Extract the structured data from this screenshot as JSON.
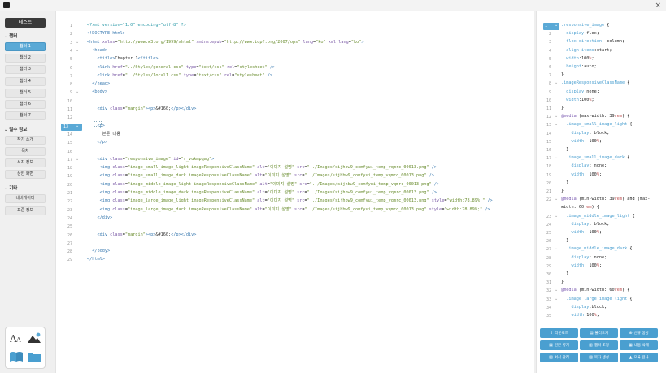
{
  "window": {
    "close_glyph": "×"
  },
  "sidebar": {
    "top_button": "테스트",
    "sections": [
      {
        "label": "챕터"
      },
      {
        "label": "필수 정보"
      },
      {
        "label": "기타"
      }
    ],
    "chapters": [
      "챕터 1",
      "챕터 2",
      "챕터 3",
      "챕터 4",
      "챕터 5",
      "챕터 6",
      "챕터 7"
    ],
    "required_info": [
      "작가 소개",
      "목차",
      "서지 정보",
      "상한 화면"
    ],
    "etc": [
      "내비게이터",
      "표준 정보"
    ],
    "tools": [
      "font-icon",
      "image-icon",
      "book-icon",
      "folder-icon"
    ]
  },
  "editor": {
    "highlighted_line": "13",
    "lines": [
      {
        "n": "1",
        "fold": "",
        "html": "<span class='pi'>&lt;?xml version=\"1.0\" encoding=\"utf-8\" ?&gt;</span>"
      },
      {
        "n": "2",
        "fold": "",
        "html": "<span class='tag'>&lt;!DOCTYPE html&gt;</span>"
      },
      {
        "n": "3",
        "fold": "⌄",
        "html": "<span class='tag'>&lt;html</span> <span class='attr'>xmlns</span>=<span class='str'>\"http://www.w3.org/1999/xhtml\"</span> <span class='attr'>xmlns:epub</span>=<span class='str'>\"http://www.idpf.org/2007/ops\"</span> <span class='attr'>lang</span>=<span class='str'>\"ko\"</span> <span class='attr'>xml:lang</span>=<span class='str'>\"ko\"</span><span class='tag'>&gt;</span>"
      },
      {
        "n": "4",
        "fold": "⌄",
        "html": "  <span class='tag'>&lt;head&gt;</span>"
      },
      {
        "n": "5",
        "fold": "",
        "html": "    <span class='tag'>&lt;title&gt;</span><span class='txt'>Chapter 1</span><span class='tag'>&lt;/title&gt;</span>"
      },
      {
        "n": "6",
        "fold": "",
        "html": "    <span class='tag'>&lt;link</span> <span class='attr'>href</span>=<span class='str'>\"../Styles/general.css\"</span> <span class='attr'>type</span>=<span class='str'>\"text/css\"</span> <span class='attr'>rel</span>=<span class='str'>\"stylesheet\"</span> <span class='tag'>/&gt;</span>"
      },
      {
        "n": "7",
        "fold": "",
        "html": "    <span class='tag'>&lt;link</span> <span class='attr'>href</span>=<span class='str'>\"../Styles/local1.css\"</span> <span class='attr'>type</span>=<span class='str'>\"text/css\"</span> <span class='attr'>rel</span>=<span class='str'>\"stylesheet\"</span> <span class='tag'>/&gt;</span>"
      },
      {
        "n": "8",
        "fold": "",
        "html": "  <span class='tag'>&lt;/head&gt;</span>"
      },
      {
        "n": "9",
        "fold": "⌄",
        "html": "  <span class='tag'>&lt;body&gt;</span>"
      },
      {
        "n": "10",
        "fold": "",
        "html": ""
      },
      {
        "n": "11",
        "fold": "",
        "html": "    <span class='tag'>&lt;div</span> <span class='attr'>class</span>=<span class='str'>\"margin\"</span><span class='tag'>&gt;&lt;p&gt;</span><span class='txt'>&amp;#160;</span><span class='tag'>&lt;/p&gt;&lt;/div&gt;</span>"
      },
      {
        "n": "12",
        "fold": "",
        "html": ""
      },
      {
        "n": "13",
        "fold": "⌄",
        "html": "    <span class='tag'>&lt;p&gt;</span>"
      },
      {
        "n": "14",
        "fold": "",
        "html": "      <span class='txt'>본문 내용</span>"
      },
      {
        "n": "15",
        "fold": "",
        "html": "    <span class='tag'>&lt;/p&gt;</span>"
      },
      {
        "n": "16",
        "fold": "",
        "html": ""
      },
      {
        "n": "17",
        "fold": "⌄",
        "html": "    <span class='tag'>&lt;div</span> <span class='attr'>class</span>=<span class='str'>\"responsive_image\"</span> <span class='attr'>id</span>=<span class='str'>\"r_vukmpqag\"</span><span class='tag'>&gt;</span>"
      },
      {
        "n": "18",
        "fold": "",
        "html": "     <span class='tag'>&lt;img</span> <span class='attr'>class</span>=<span class='str'>\"image_small_image_light imageResponsiveClassName\"</span> <span class='attr'>alt</span>=<span class='str'>\"이미지 설명\"</span> <span class='attr'>src</span>=<span class='str'>\"../Images/sijhbw9_comfyui_temp_vqmrc_00013.png\"</span> <span class='tag'>/&gt;</span>"
      },
      {
        "n": "19",
        "fold": "",
        "html": "     <span class='tag'>&lt;img</span> <span class='attr'>class</span>=<span class='str'>\"image_small_image_dark imageResponsiveClassName\"</span> <span class='attr'>alt</span>=<span class='str'>\"이미지 설명\"</span> <span class='attr'>src</span>=<span class='str'>\"../Images/sijhbw9_comfyui_temp_vqmrc_00013.png\"</span> <span class='tag'>/&gt;</span>"
      },
      {
        "n": "20",
        "fold": "",
        "html": "     <span class='tag'>&lt;img</span> <span class='attr'>class</span>=<span class='str'>\"image_middle_image_light imageResponsiveClassName\"</span> <span class='attr'>alt</span>=<span class='str'>\"이미지 설명\"</span> <span class='attr'>src</span>=<span class='str'>\"../Images/sijhbw9_comfyui_temp_vqmrc_00013.png\"</span> <span class='tag'>/&gt;</span>"
      },
      {
        "n": "21",
        "fold": "",
        "html": "     <span class='tag'>&lt;img</span> <span class='attr'>class</span>=<span class='str'>\"image_middle_image_dark imageResponsiveClassName\"</span> <span class='attr'>alt</span>=<span class='str'>\"이미지 설명\"</span> <span class='attr'>src</span>=<span class='str'>\"../Images/sijhbw9_comfyui_temp_vqmrc_00013.png\"</span> <span class='tag'>/&gt;</span>"
      },
      {
        "n": "22",
        "fold": "",
        "html": "     <span class='tag'>&lt;img</span> <span class='attr'>class</span>=<span class='str'>\"image_large_image_light imageResponsiveClassName\"</span> <span class='attr'>alt</span>=<span class='str'>\"이미지 설명\"</span> <span class='attr'>src</span>=<span class='str'>\"../Images/sijhbw9_comfyui_temp_vqmrc_00013.png\"</span> <span class='attr'>style</span>=<span class='str'>\"width:78.89%;\"</span> <span class='tag'>/&gt;</span>"
      },
      {
        "n": "23",
        "fold": "",
        "html": "     <span class='tag'>&lt;img</span> <span class='attr'>class</span>=<span class='str'>\"image_large_image_dark imageResponsiveClassName\"</span> <span class='attr'>alt</span>=<span class='str'>\"이미지 설명\"</span> <span class='attr'>src</span>=<span class='str'>\"../Images/sijhbw9_comfyui_temp_vqmrc_00013.png\"</span> <span class='attr'>style</span>=<span class='str'>\"width:78.89%;\"</span> <span class='tag'>/&gt;</span>"
      },
      {
        "n": "24",
        "fold": "",
        "html": "    <span class='tag'>&lt;/div&gt;</span>"
      },
      {
        "n": "25",
        "fold": "",
        "html": ""
      },
      {
        "n": "26",
        "fold": "",
        "html": "    <span class='tag'>&lt;div</span> <span class='attr'>class</span>=<span class='str'>\"margin\"</span><span class='tag'>&gt;&lt;p&gt;</span><span class='txt'>&amp;#160;</span><span class='tag'>&lt;/p&gt;&lt;/div&gt;</span>"
      },
      {
        "n": "27",
        "fold": "",
        "html": ""
      },
      {
        "n": "28",
        "fold": "",
        "html": "  <span class='tag'>&lt;/body&gt;</span>"
      },
      {
        "n": "29",
        "fold": "",
        "html": "<span class='tag'>&lt;/html&gt;</span>"
      }
    ]
  },
  "css": {
    "highlighted_line": "1",
    "lines": [
      {
        "n": "1",
        "fold": "⌄",
        "html": "<span class='sel'>.responsive_image</span> {"
      },
      {
        "n": "2",
        "fold": "",
        "html": "  <span class='prop'>display</span>:<span class='val'>flex</span>;"
      },
      {
        "n": "3",
        "fold": "",
        "html": "  <span class='prop'>flex-direction</span>: <span class='val'>column</span>;"
      },
      {
        "n": "4",
        "fold": "",
        "html": "  <span class='prop'>align-items</span>:<span class='val'>start</span>;"
      },
      {
        "n": "5",
        "fold": "",
        "html": "  <span class='prop'>width</span>:<span class='val'>100</span><span class='unit'>%</span>;"
      },
      {
        "n": "6",
        "fold": "",
        "html": "  <span class='prop'>height</span>:<span class='val'>auto</span>;"
      },
      {
        "n": "7",
        "fold": "",
        "html": "}"
      },
      {
        "n": "8",
        "fold": "⌄",
        "html": "<span class='sel'>.imageResponsiveClassName</span> {"
      },
      {
        "n": "9",
        "fold": "",
        "html": "  <span class='prop'>display</span>:<span class='val'>none</span>;"
      },
      {
        "n": "10",
        "fold": "",
        "html": "  <span class='prop'>width</span>:<span class='val'>100</span><span class='unit'>%</span>;"
      },
      {
        "n": "11",
        "fold": "",
        "html": "}"
      },
      {
        "n": "12",
        "fold": "⌄",
        "html": "<span class='at'>@media</span> (<span class='val'>max-width</span>: <span class='val'>39</span><span class='unit'>rem</span>) {"
      },
      {
        "n": "13",
        "fold": "⌄",
        "html": "  <span class='sel'>.image_small_image_light</span> {"
      },
      {
        "n": "14",
        "fold": "",
        "html": "    <span class='prop'>display</span>: <span class='val'>block</span>;"
      },
      {
        "n": "15",
        "fold": "",
        "html": "    <span class='prop'>width</span>: <span class='val'>100</span><span class='unit'>%</span>;"
      },
      {
        "n": "16",
        "fold": "",
        "html": "  }"
      },
      {
        "n": "17",
        "fold": "⌄",
        "html": "  <span class='sel'>.image_small_image_dark</span> {"
      },
      {
        "n": "18",
        "fold": "",
        "html": "    <span class='prop'>display</span>: <span class='val'>none</span>;"
      },
      {
        "n": "19",
        "fold": "",
        "html": "    <span class='prop'>width</span>: <span class='val'>100</span><span class='unit'>%</span>;"
      },
      {
        "n": "20",
        "fold": "",
        "html": "  }"
      },
      {
        "n": "21",
        "fold": "",
        "html": "}"
      },
      {
        "n": "22",
        "fold": "⌄",
        "html": "<span class='at'>@media</span> (<span class='val'>min-width</span>: <span class='val'>39</span><span class='unit'>rem</span>) and (<span class='val'>max-</span>"
      },
      {
        "n": "",
        "fold": "",
        "html": "<span class='val'>width</span>: <span class='val'>60</span><span class='unit'>rem</span>) {"
      },
      {
        "n": "23",
        "fold": "⌄",
        "html": "  <span class='sel'>.image_middle_image_light</span> {"
      },
      {
        "n": "24",
        "fold": "",
        "html": "    <span class='prop'>display</span>: <span class='val'>block</span>;"
      },
      {
        "n": "25",
        "fold": "",
        "html": "    <span class='prop'>width</span>: <span class='val'>100</span><span class='unit'>%</span>;"
      },
      {
        "n": "26",
        "fold": "",
        "html": "  }"
      },
      {
        "n": "27",
        "fold": "⌄",
        "html": "  <span class='sel'>.image_middle_image_dark</span> {"
      },
      {
        "n": "28",
        "fold": "",
        "html": "    <span class='prop'>display</span>: <span class='val'>none</span>;"
      },
      {
        "n": "29",
        "fold": "",
        "html": "    <span class='prop'>width</span>: <span class='val'>100</span><span class='unit'>%</span>;"
      },
      {
        "n": "30",
        "fold": "",
        "html": "  }"
      },
      {
        "n": "31",
        "fold": "",
        "html": "}"
      },
      {
        "n": "32",
        "fold": "⌄",
        "html": "<span class='at'>@media</span> (<span class='val'>min-width</span>: <span class='val'>60</span><span class='unit'>rem</span>) {"
      },
      {
        "n": "33",
        "fold": "⌄",
        "html": "  <span class='sel'>.image_large_image_light</span> {"
      },
      {
        "n": "34",
        "fold": "",
        "html": "    <span class='prop'>display</span>:<span class='val'>block</span>;"
      },
      {
        "n": "35",
        "fold": "",
        "html": "    <span class='prop'>width</span>:<span class='val'>100</span><span class='unit'>%</span>;"
      }
    ]
  },
  "actions": [
    {
      "icon": "upload-icon",
      "glyph": "⇪",
      "label": "다운로드"
    },
    {
      "icon": "folder-open-icon",
      "glyph": "▤",
      "label": "불러오기"
    },
    {
      "icon": "new-project-icon",
      "glyph": "⊕",
      "label": "신규 생성"
    },
    {
      "icon": "save-icon",
      "glyph": "▣",
      "label": "원본 넣기"
    },
    {
      "icon": "chapter-icon",
      "glyph": "▥",
      "label": "챕터 조정"
    },
    {
      "icon": "delete-icon",
      "glyph": "▦",
      "label": "내용 삭제"
    },
    {
      "icon": "style-icon",
      "glyph": "▧",
      "label": "서식 관리"
    },
    {
      "icon": "toc-icon",
      "glyph": "▨",
      "label": "목차 생성"
    },
    {
      "icon": "error-check-icon",
      "glyph": "▲",
      "label": "오류 검사"
    }
  ]
}
